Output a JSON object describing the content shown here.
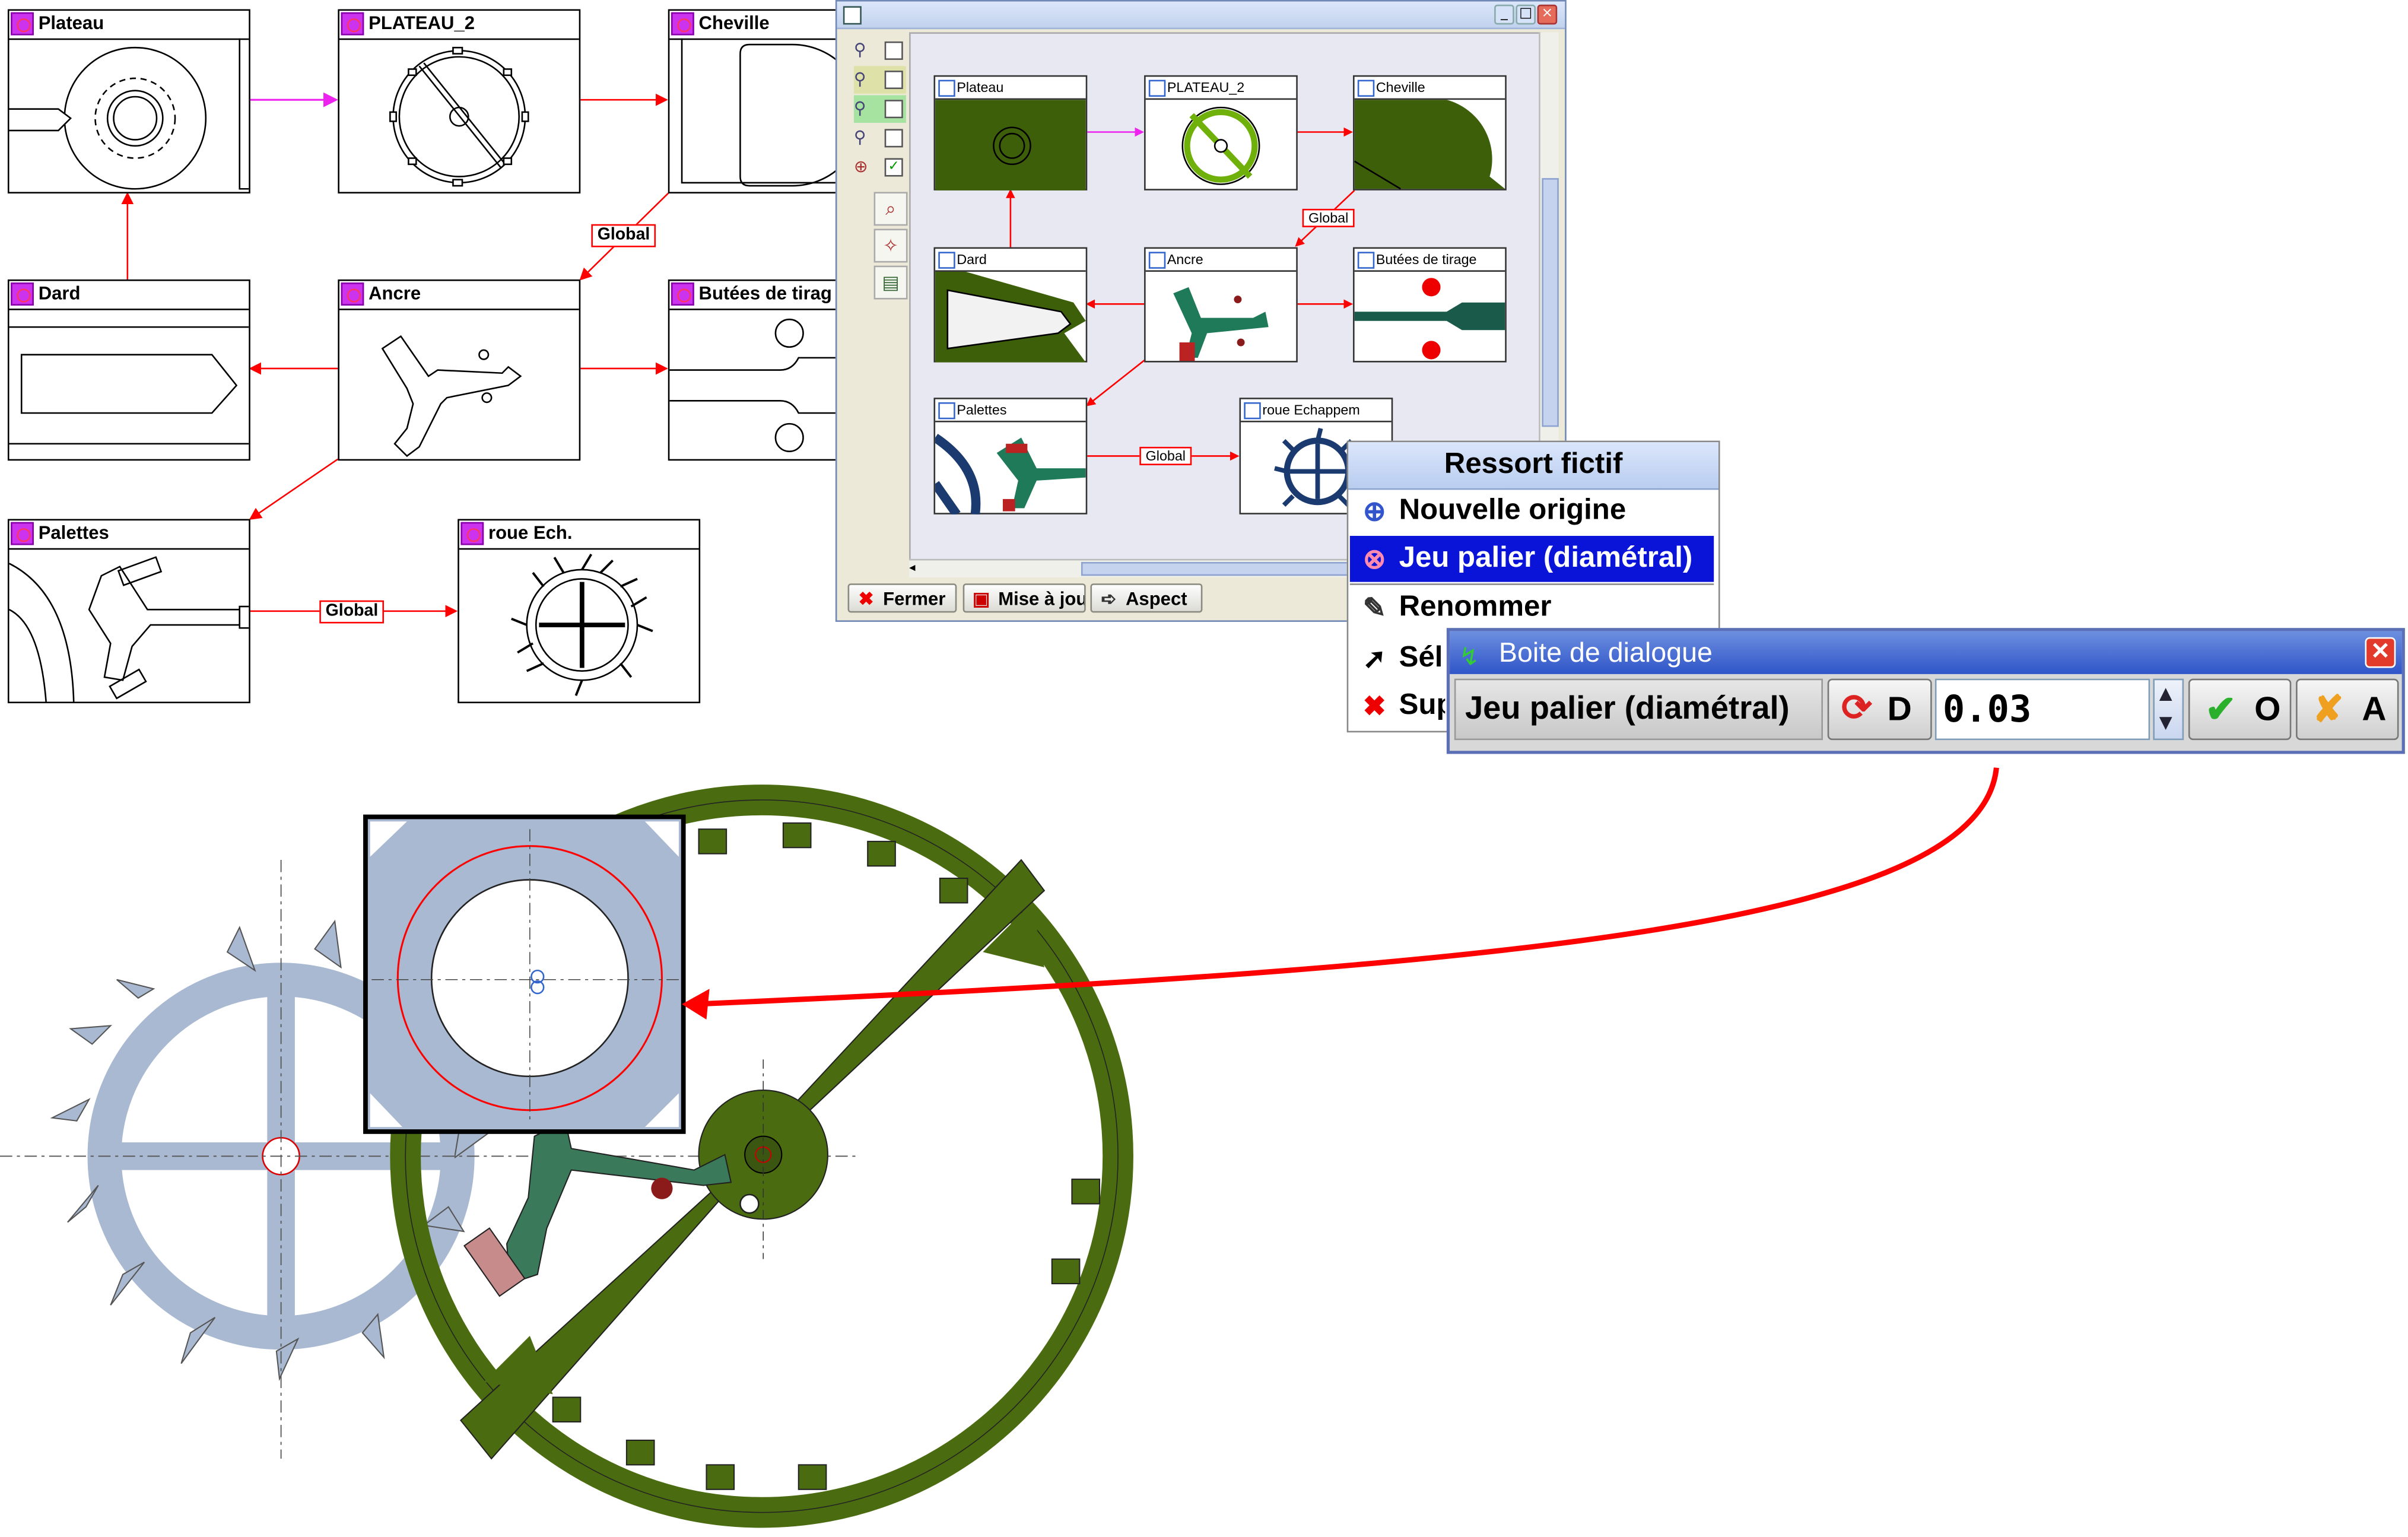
{
  "graph": {
    "nodes": [
      {
        "id": "plateau",
        "label": "Plateau"
      },
      {
        "id": "plateau2",
        "label": "PLATEAU_2"
      },
      {
        "id": "cheville",
        "label": "Cheville"
      },
      {
        "id": "dard",
        "label": "Dard"
      },
      {
        "id": "ancre",
        "label": "Ancre"
      },
      {
        "id": "butees",
        "label": "Butées de tirag"
      },
      {
        "id": "palettes",
        "label": "Palettes"
      },
      {
        "id": "roue",
        "label": "roue Ech."
      }
    ],
    "edge_labels": {
      "global1": "Global",
      "global2": "Global"
    }
  },
  "window": {
    "nodes": {
      "plateau": "Plateau",
      "plateau2": "PLATEAU_2",
      "cheville": "Cheville",
      "dard": "Dard",
      "ancre": "Ancre",
      "butees": "Butées de tirage",
      "palettes": "Palettes",
      "roue": "roue Echappem"
    },
    "edge_labels": {
      "global1": "Global",
      "global2": "Global"
    },
    "buttons": {
      "close": "Fermer",
      "update": "Mise à jou",
      "aspect": "Aspect"
    },
    "side_checks": [
      false,
      false,
      false,
      false,
      true
    ]
  },
  "context_menu": {
    "title": "Ressort fictif",
    "items": [
      {
        "label": "Nouvelle origine",
        "icon": "target-icon",
        "selected": false
      },
      {
        "label": "Jeu palier (diamétral)",
        "icon": "bearing-icon",
        "selected": true
      },
      {
        "label": "Renommer",
        "icon": "rename-icon",
        "selected": false
      },
      {
        "label": "Sél",
        "icon": "cursor-icon",
        "selected": false
      },
      {
        "label": "Sup",
        "icon": "delete-icon",
        "selected": false
      }
    ]
  },
  "dialog": {
    "title": "Boite de dialogue",
    "field_label": "Jeu palier (diamétral)",
    "default_label": "D",
    "value": "0.03",
    "ok_label": "O",
    "cancel_label": "A"
  },
  "colors": {
    "green": "#4a6b10",
    "steel": "#a9b9d1",
    "highlight": "#0a14d8",
    "arrow_red": "#ff0000",
    "magenta": "#ee22ee"
  }
}
